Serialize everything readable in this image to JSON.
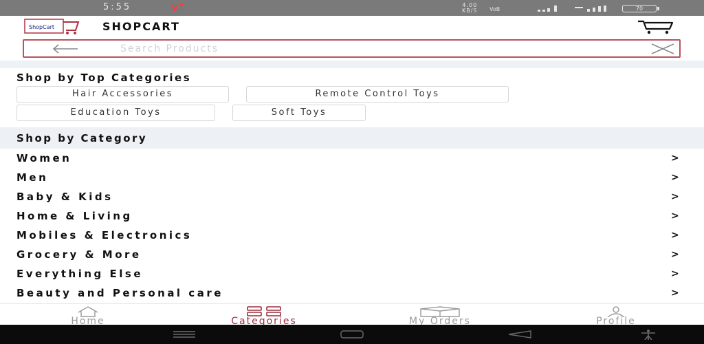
{
  "status_bar": {
    "time": "5:55",
    "network_speed": "4.00",
    "network_unit": "KB/S",
    "battery": "70"
  },
  "header": {
    "title": "SHOPCART",
    "logo_text": "ShopCart"
  },
  "search": {
    "placeholder": "Search Products"
  },
  "top_categories": {
    "title": "Shop by Top Categories",
    "chips": [
      "Hair Accessories",
      "Remote Control Toys",
      "Education Toys",
      "Soft Toys"
    ]
  },
  "categories": {
    "title": "Shop by Category",
    "chevron": ">",
    "items": [
      "Women",
      "Men",
      "Baby & Kids",
      "Home & Living",
      "Mobiles & Electronics",
      "Grocery & More",
      "Everything Else",
      "Beauty and Personal care"
    ]
  },
  "bottom_nav": {
    "items": [
      {
        "label": "Home",
        "icon": "home-icon",
        "active": false
      },
      {
        "label": "Categories",
        "icon": "grid-icon",
        "active": true
      },
      {
        "label": "My Orders",
        "icon": "box-icon",
        "active": false
      },
      {
        "label": "Profile",
        "icon": "person-icon",
        "active": false
      }
    ]
  },
  "colors": {
    "accent": "#9b2d3f",
    "search_border": "#b9525e",
    "section_band": "#edf1f5"
  }
}
